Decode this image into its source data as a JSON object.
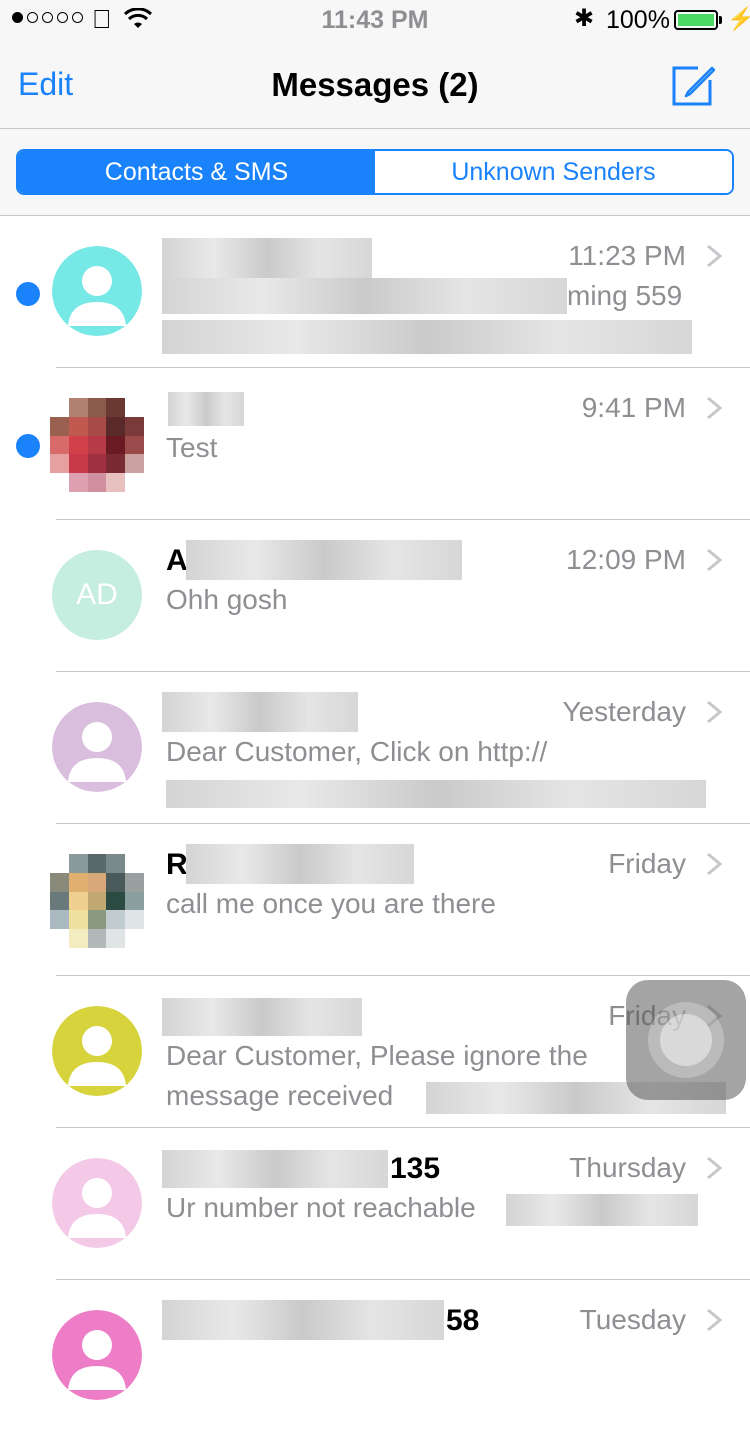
{
  "status_bar": {
    "time": "11:43 PM",
    "battery_pct": "100%",
    "battery_level": 1.0,
    "signal_bars": 1,
    "icons": [
      "apple-icon",
      "wifi-icon",
      "bluetooth-icon",
      "battery-icon",
      "charging-icon"
    ]
  },
  "nav": {
    "edit_label": "Edit",
    "title": "Messages (2)",
    "compose_icon": "compose-icon"
  },
  "segment": {
    "options": [
      "Contacts & SMS",
      "Unknown Senders"
    ],
    "selected": "Contacts & SMS"
  },
  "colors": {
    "accent": "#1a82fb",
    "secondary_text": "#8e8e93",
    "separator": "#c8c7cc"
  },
  "conversations": [
    {
      "name": "",
      "time": "11:23 PM",
      "preview": "ming 559",
      "unread": true,
      "avatar_color": "#76e8e6"
    },
    {
      "name": "",
      "time": "9:41 PM",
      "preview": "Test",
      "unread": true,
      "avatar_color": "photo"
    },
    {
      "name": "A",
      "time": "12:09 PM",
      "preview": "Ohh gosh",
      "unread": false,
      "avatar_initials": "AD",
      "avatar_color": "#c5eee0"
    },
    {
      "name": "",
      "time": "Yesterday",
      "preview": "Dear Customer, Click on  http://",
      "unread": false,
      "avatar_color": "#d9bfdd"
    },
    {
      "name": "R",
      "time": "Friday",
      "preview": "call me once you are there",
      "unread": false,
      "avatar_color": "photo"
    },
    {
      "name": "",
      "time": "Friday",
      "preview": "Dear Customer, Please ignore the",
      "preview2": "message received",
      "unread": false,
      "avatar_color": "#d6d33c"
    },
    {
      "name": "135",
      "time": "Thursday",
      "preview": "Ur number not reachable",
      "unread": false,
      "avatar_color": "#f4c9e7"
    },
    {
      "name": "58",
      "time": "Tuesday",
      "preview": "",
      "unread": false,
      "avatar_color": "#ee7dc7"
    }
  ]
}
